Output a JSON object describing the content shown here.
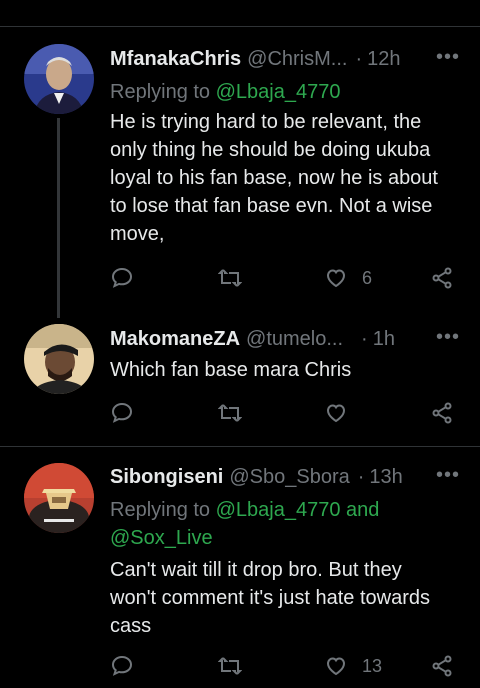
{
  "tweets": [
    {
      "name": "MfanakaChris",
      "handle": "@ChrisM...",
      "dot": "·",
      "time": "12h",
      "reply_prefix": "Replying to",
      "reply_to": "@Lbaja_4770",
      "reply_and": "",
      "reply_to2": "",
      "text_lines": [
        "He is  trying hard to be relevant, the",
        "only thing he should be doing ukuba",
        "loyal to his fan base, now he is about",
        "to lose that fan base evn. Not a wise",
        "move,"
      ],
      "like_count": "6"
    },
    {
      "name": "MakomaneZA",
      "handle": "@tumelo...",
      "dot": "·",
      "time": "1h",
      "text_lines": [
        "Which fan base mara Chris"
      ],
      "like_count": ""
    },
    {
      "name": "Sibongiseni",
      "handle": "@Sbo_Sbora",
      "dot": "·",
      "time": "13h",
      "reply_prefix": "Replying to",
      "reply_to": "@Lbaja_4770 and",
      "reply_to2": "@Sox_Live",
      "text_lines": [
        "Can't wait till it drop bro. But they",
        "won't comment it's just hate towards",
        "cass"
      ],
      "like_count": "13"
    }
  ],
  "more_label": "•••",
  "colors": {
    "accent": "#2ea84f",
    "muted": "#71767b",
    "background": "#000000"
  },
  "icons": [
    "reply-icon",
    "retweet-icon",
    "like-icon",
    "share-icon",
    "more-icon"
  ]
}
